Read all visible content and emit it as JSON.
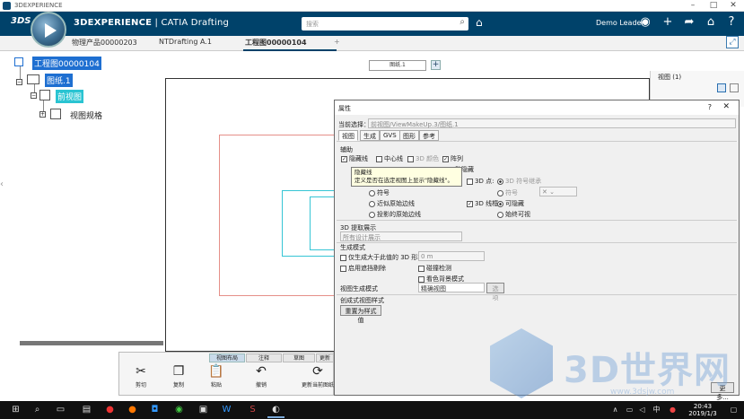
{
  "window": {
    "title": "3DEXPERIENCE"
  },
  "appbar": {
    "brand_bold": "3DEXPERIENCE",
    "brand_rest": " | CATIA Drafting",
    "search_placeholder": "搜索",
    "user": "Demo Leader"
  },
  "tabs": [
    {
      "label": "物理产品00000203"
    },
    {
      "label": "NTDrafting A.1"
    },
    {
      "label": "工程图00000104"
    },
    {
      "label": "+"
    }
  ],
  "tree": {
    "root": "工程图00000104",
    "sheet": "图纸.1",
    "view": "前视图",
    "spec": "视图规格"
  },
  "canvas": {
    "sheet_button": "图纸.1",
    "add_sheet": "+"
  },
  "right_panel": {
    "title": "视图 (1)"
  },
  "dialog": {
    "title": "属性",
    "help": "?",
    "close": "✕",
    "current_selection_label": "当前选择：",
    "current_selection_value": "前视图/ViewMakeUp.3/图纸.1",
    "tabs": [
      "视图",
      "生成",
      "GVS",
      "图形",
      "参考"
    ],
    "section_aux": "辅助",
    "hidden_lines": "隐藏线",
    "center_lines": "中心线",
    "color_3d": "3D 颜色",
    "array": "阵列",
    "obscured_partial": "助隐藏",
    "point_3d": "3D 点:",
    "inherit_3d": "3D 符号继承",
    "symbol": "符号",
    "symbol2": "符号",
    "approx_edge": "近似原始边线",
    "projected_edge": "投影的原始边线",
    "wireframe_3d": "3D 线框",
    "can_hide": "可隐藏",
    "always_visible": "始终可视",
    "section_3d_extract": "3D 提取展示",
    "all_design_show": "所有设计展示",
    "section_gen_mode": "生成模式",
    "gen_only_larger": "仅生成大于此值的 3D 形状",
    "gen_value": "0 m",
    "occlusion_culling": "启用遮挡剔除",
    "interference_check": "碰撞检测",
    "bg_mode": "看色背景模式",
    "view_gen_mode": "视图生成模式",
    "view_gen_value": "精确视图",
    "options": "选项",
    "section_dress_style": "创成式视图样式",
    "reset_style": "重置为样式值",
    "more": "更多..."
  },
  "tooltip": {
    "line1": "隐藏线",
    "line2": "定义是否在选定视图上显示\"隐藏线\"。"
  },
  "bottom": {
    "tabs": [
      "视图布局",
      "注释",
      "草图",
      "更新"
    ],
    "items": [
      "剪切",
      "复制",
      "粘贴",
      "撤销",
      "更新当前图纸"
    ]
  },
  "taskbar": {
    "time": "20:43",
    "date": "2019/1/3"
  },
  "watermark": {
    "text": "3D世界网",
    "sub": "www.3dsjw.com"
  },
  "colors": {
    "appbar": "#00426a",
    "selection": "#1e6fd1",
    "selection_alt": "#2ac4d2",
    "view_frame": "#36c5d5",
    "red_frame": "#e58f88"
  }
}
